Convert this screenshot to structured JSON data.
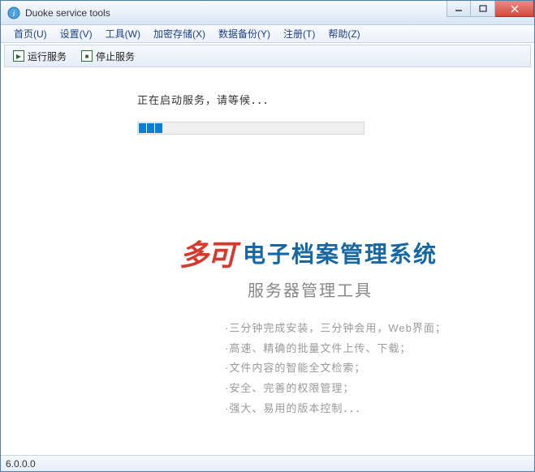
{
  "window": {
    "title": "Duoke service tools"
  },
  "menu": {
    "items": [
      {
        "label": "首页(U)"
      },
      {
        "label": "设置(V)"
      },
      {
        "label": "工具(W)"
      },
      {
        "label": "加密存储(X)"
      },
      {
        "label": "数据备份(Y)"
      },
      {
        "label": "注册(T)"
      },
      {
        "label": "帮助(Z)"
      }
    ]
  },
  "toolbar": {
    "run_label": "运行服务",
    "stop_label": "停止服务"
  },
  "main": {
    "status_text": "正在启动服务，请等候．．．",
    "progress_blocks": 3
  },
  "brand": {
    "logo_text": "多可",
    "title": "电子档案管理系统",
    "subtitle": "服务器管理工具",
    "features": [
      "·三分钟完成安装，三分钟会用，Web界面；",
      "·高速、精确的批量文件上传、下载；",
      "·文件内容的智能全文检索；",
      "·安全、完善的权限管理；",
      "·强大、易用的版本控制．．．"
    ]
  },
  "statusbar": {
    "version": "6.0.0.0"
  }
}
